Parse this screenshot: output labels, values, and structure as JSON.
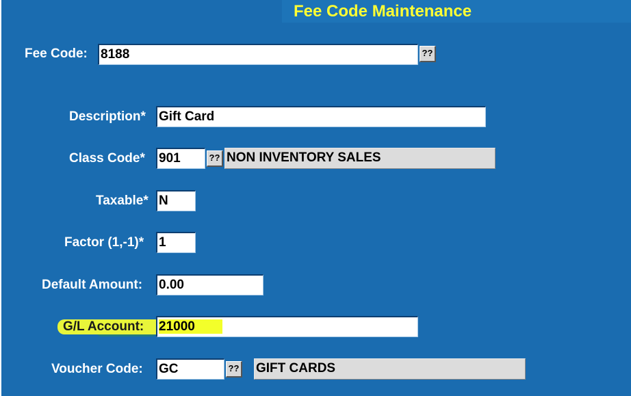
{
  "window": {
    "title": "Fee Code Maintenance"
  },
  "form": {
    "fee_code": {
      "label": "Fee Code:",
      "value": "8188",
      "lookup_label": "??"
    },
    "description": {
      "label": "Description*",
      "value": "Gift Card"
    },
    "class_code": {
      "label": "Class Code*",
      "value": "901",
      "lookup_label": "??",
      "description": "NON INVENTORY SALES"
    },
    "taxable": {
      "label": "Taxable*",
      "value": "N"
    },
    "factor": {
      "label": "Factor (1,-1)*",
      "value": "1"
    },
    "default_amount": {
      "label": "Default Amount:",
      "value": "0.00"
    },
    "gl_account": {
      "label": "G/L Account:",
      "value": "21000",
      "highlight_color": "#f3ff2a"
    },
    "voucher_code": {
      "label": "Voucher Code:",
      "value": "GC",
      "lookup_label": "??",
      "description": "GIFT CARDS"
    }
  },
  "colors": {
    "background": "#1a6cb0",
    "title_text": "#ffff33",
    "label_text": "#ffffff",
    "readonly_field": "#dcdcdc"
  }
}
